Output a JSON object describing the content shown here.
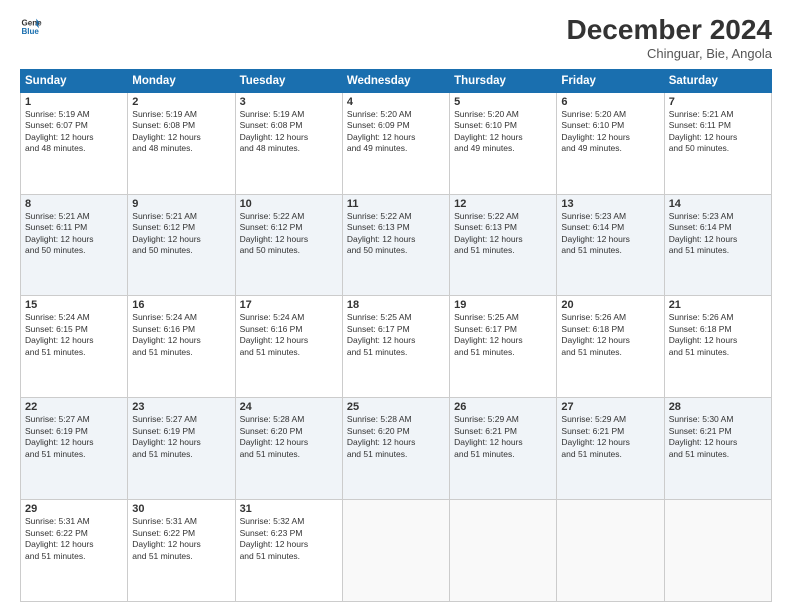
{
  "logo": {
    "line1": "General",
    "line2": "Blue"
  },
  "title": "December 2024",
  "subtitle": "Chinguar, Bie, Angola",
  "days_header": [
    "Sunday",
    "Monday",
    "Tuesday",
    "Wednesday",
    "Thursday",
    "Friday",
    "Saturday"
  ],
  "weeks": [
    [
      {
        "day": "1",
        "info": "Sunrise: 5:19 AM\nSunset: 6:07 PM\nDaylight: 12 hours\nand 48 minutes."
      },
      {
        "day": "2",
        "info": "Sunrise: 5:19 AM\nSunset: 6:08 PM\nDaylight: 12 hours\nand 48 minutes."
      },
      {
        "day": "3",
        "info": "Sunrise: 5:19 AM\nSunset: 6:08 PM\nDaylight: 12 hours\nand 48 minutes."
      },
      {
        "day": "4",
        "info": "Sunrise: 5:20 AM\nSunset: 6:09 PM\nDaylight: 12 hours\nand 49 minutes."
      },
      {
        "day": "5",
        "info": "Sunrise: 5:20 AM\nSunset: 6:10 PM\nDaylight: 12 hours\nand 49 minutes."
      },
      {
        "day": "6",
        "info": "Sunrise: 5:20 AM\nSunset: 6:10 PM\nDaylight: 12 hours\nand 49 minutes."
      },
      {
        "day": "7",
        "info": "Sunrise: 5:21 AM\nSunset: 6:11 PM\nDaylight: 12 hours\nand 50 minutes."
      }
    ],
    [
      {
        "day": "8",
        "info": "Sunrise: 5:21 AM\nSunset: 6:11 PM\nDaylight: 12 hours\nand 50 minutes."
      },
      {
        "day": "9",
        "info": "Sunrise: 5:21 AM\nSunset: 6:12 PM\nDaylight: 12 hours\nand 50 minutes."
      },
      {
        "day": "10",
        "info": "Sunrise: 5:22 AM\nSunset: 6:12 PM\nDaylight: 12 hours\nand 50 minutes."
      },
      {
        "day": "11",
        "info": "Sunrise: 5:22 AM\nSunset: 6:13 PM\nDaylight: 12 hours\nand 50 minutes."
      },
      {
        "day": "12",
        "info": "Sunrise: 5:22 AM\nSunset: 6:13 PM\nDaylight: 12 hours\nand 51 minutes."
      },
      {
        "day": "13",
        "info": "Sunrise: 5:23 AM\nSunset: 6:14 PM\nDaylight: 12 hours\nand 51 minutes."
      },
      {
        "day": "14",
        "info": "Sunrise: 5:23 AM\nSunset: 6:14 PM\nDaylight: 12 hours\nand 51 minutes."
      }
    ],
    [
      {
        "day": "15",
        "info": "Sunrise: 5:24 AM\nSunset: 6:15 PM\nDaylight: 12 hours\nand 51 minutes."
      },
      {
        "day": "16",
        "info": "Sunrise: 5:24 AM\nSunset: 6:16 PM\nDaylight: 12 hours\nand 51 minutes."
      },
      {
        "day": "17",
        "info": "Sunrise: 5:24 AM\nSunset: 6:16 PM\nDaylight: 12 hours\nand 51 minutes."
      },
      {
        "day": "18",
        "info": "Sunrise: 5:25 AM\nSunset: 6:17 PM\nDaylight: 12 hours\nand 51 minutes."
      },
      {
        "day": "19",
        "info": "Sunrise: 5:25 AM\nSunset: 6:17 PM\nDaylight: 12 hours\nand 51 minutes."
      },
      {
        "day": "20",
        "info": "Sunrise: 5:26 AM\nSunset: 6:18 PM\nDaylight: 12 hours\nand 51 minutes."
      },
      {
        "day": "21",
        "info": "Sunrise: 5:26 AM\nSunset: 6:18 PM\nDaylight: 12 hours\nand 51 minutes."
      }
    ],
    [
      {
        "day": "22",
        "info": "Sunrise: 5:27 AM\nSunset: 6:19 PM\nDaylight: 12 hours\nand 51 minutes."
      },
      {
        "day": "23",
        "info": "Sunrise: 5:27 AM\nSunset: 6:19 PM\nDaylight: 12 hours\nand 51 minutes."
      },
      {
        "day": "24",
        "info": "Sunrise: 5:28 AM\nSunset: 6:20 PM\nDaylight: 12 hours\nand 51 minutes."
      },
      {
        "day": "25",
        "info": "Sunrise: 5:28 AM\nSunset: 6:20 PM\nDaylight: 12 hours\nand 51 minutes."
      },
      {
        "day": "26",
        "info": "Sunrise: 5:29 AM\nSunset: 6:21 PM\nDaylight: 12 hours\nand 51 minutes."
      },
      {
        "day": "27",
        "info": "Sunrise: 5:29 AM\nSunset: 6:21 PM\nDaylight: 12 hours\nand 51 minutes."
      },
      {
        "day": "28",
        "info": "Sunrise: 5:30 AM\nSunset: 6:21 PM\nDaylight: 12 hours\nand 51 minutes."
      }
    ],
    [
      {
        "day": "29",
        "info": "Sunrise: 5:31 AM\nSunset: 6:22 PM\nDaylight: 12 hours\nand 51 minutes."
      },
      {
        "day": "30",
        "info": "Sunrise: 5:31 AM\nSunset: 6:22 PM\nDaylight: 12 hours\nand 51 minutes."
      },
      {
        "day": "31",
        "info": "Sunrise: 5:32 AM\nSunset: 6:23 PM\nDaylight: 12 hours\nand 51 minutes."
      },
      {
        "day": "",
        "info": ""
      },
      {
        "day": "",
        "info": ""
      },
      {
        "day": "",
        "info": ""
      },
      {
        "day": "",
        "info": ""
      }
    ]
  ]
}
